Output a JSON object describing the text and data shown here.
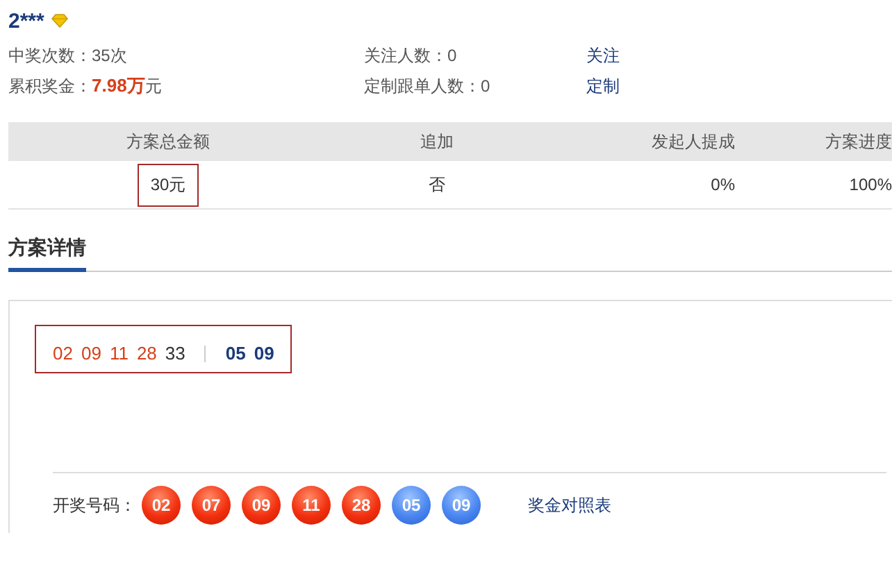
{
  "user": {
    "name": "2***"
  },
  "stats": [
    {
      "label": "中奖次数：",
      "value": "35次"
    },
    {
      "label": "关注人数：",
      "value": "0"
    },
    {
      "label": "关注",
      "kind": "link"
    },
    {
      "label": "累积奖金：",
      "value": "**7.98万**元"
    },
    {
      "label": "定制跟单人数：",
      "value": "0"
    },
    {
      "label": "定制",
      "kind": "link"
    }
  ],
  "table": {
    "columns": [
      "方案总金额",
      "追加",
      "发起人提成",
      "方案进度"
    ],
    "rows": [
      {
        "cells": [
          {
            "text": "30元",
            "boxed": true
          },
          {
            "text": "否",
            "boxed": false
          },
          {
            "text": "0%",
            "boxed": false
          },
          {
            "text": "100%",
            "boxed": false
          }
        ]
      }
    ]
  },
  "tabs": [
    {
      "label": "方案详情",
      "selected": true
    }
  ],
  "pick": {
    "numbers": [
      {
        "text": "02",
        "kind": "front",
        "hit": true
      },
      {
        "text": "09",
        "kind": "front",
        "hit": true
      },
      {
        "text": "11",
        "kind": "front",
        "hit": true
      },
      {
        "text": "28",
        "kind": "front",
        "hit": true
      },
      {
        "text": "33",
        "kind": "front",
        "hit": false
      },
      {
        "text": "05",
        "kind": "back",
        "hit": true
      },
      {
        "text": "09",
        "kind": "back",
        "hit": true
      }
    ]
  },
  "draw": {
    "label": "开奖号码：",
    "balls": [
      {
        "text": "02",
        "kind": "red"
      },
      {
        "text": "07",
        "kind": "red"
      },
      {
        "text": "09",
        "kind": "red"
      },
      {
        "text": "11",
        "kind": "red"
      },
      {
        "text": "28",
        "kind": "red"
      },
      {
        "text": "05",
        "kind": "blue"
      },
      {
        "text": "09",
        "kind": "blue"
      }
    ],
    "link": "奖金对照表"
  }
}
